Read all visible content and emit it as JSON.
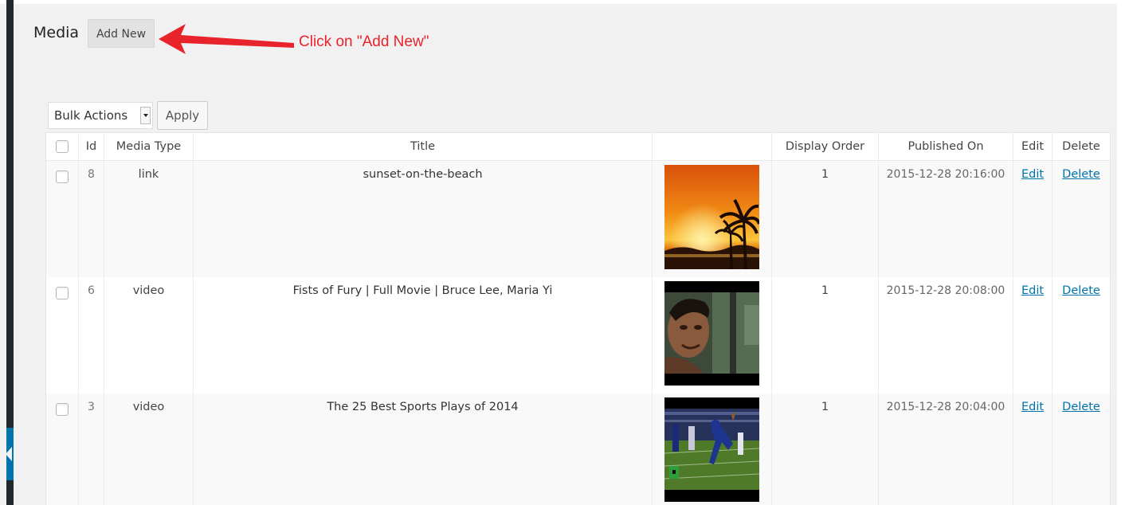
{
  "header": {
    "title": "Media",
    "add_new_label": "Add New"
  },
  "annotation": {
    "text": "Click on \"Add New\"",
    "color": "#e8232b"
  },
  "bulk": {
    "select_label": "Bulk Actions",
    "apply_label": "Apply"
  },
  "table": {
    "columns": {
      "id": "Id",
      "media_type": "Media Type",
      "title": "Title",
      "thumbnail": "",
      "display_order": "Display Order",
      "published_on": "Published On",
      "edit": "Edit",
      "delete": "Delete"
    },
    "rows": [
      {
        "id": "8",
        "media_type": "link",
        "title": "sunset-on-the-beach",
        "display_order": "1",
        "published_on": "2015-12-28 20:16:00",
        "edit": "Edit",
        "delete": "Delete",
        "thumbnail_icon": "sunset-beach-thumbnail"
      },
      {
        "id": "6",
        "media_type": "video",
        "title": "Fists of Fury | Full Movie | Bruce Lee, Maria Yi",
        "display_order": "1",
        "published_on": "2015-12-28 20:08:00",
        "edit": "Edit",
        "delete": "Delete",
        "thumbnail_icon": "movie-still-thumbnail"
      },
      {
        "id": "3",
        "media_type": "video",
        "title": "The 25 Best Sports Plays of 2014",
        "display_order": "1",
        "published_on": "2015-12-28 20:04:00",
        "edit": "Edit",
        "delete": "Delete",
        "thumbnail_icon": "football-play-thumbnail"
      }
    ]
  },
  "colors": {
    "link": "#0073aa",
    "admin_bar": "#23282d",
    "admin_accent": "#0073aa",
    "annotation_red": "#e8232b"
  }
}
